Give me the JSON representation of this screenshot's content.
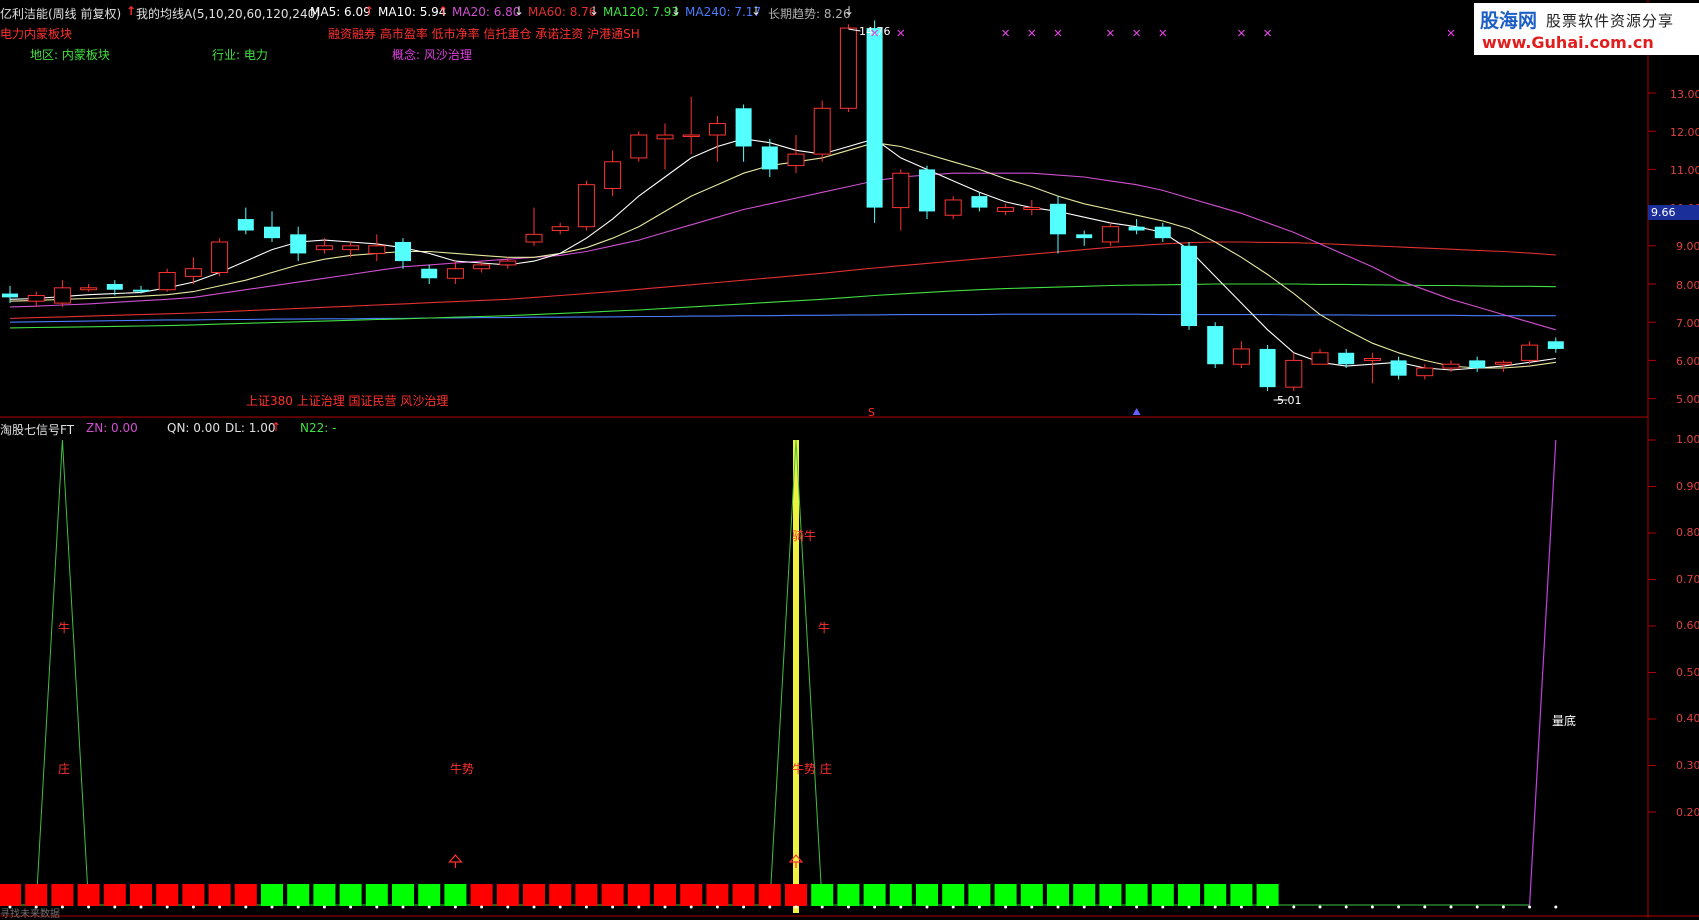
{
  "header": {
    "title": "亿利洁能(周线 前复权)",
    "ma_indicator": "我的均线A(5,10,20,60,120,240)",
    "ma_values": [
      {
        "label": "MA5: 6.09",
        "color": "#ffffff",
        "arrow": "↑"
      },
      {
        "label": "MA10: 5.94",
        "color": "#ffffff",
        "arrow": "↑"
      },
      {
        "label": "MA20: 6.80",
        "color": "#d050d0",
        "arrow": "↓"
      },
      {
        "label": "MA60: 8.76",
        "color": "#e03030",
        "arrow": "↓"
      },
      {
        "label": "MA120: 7.93",
        "color": "#40e040",
        "arrow": "↓"
      },
      {
        "label": "MA240: 7.17",
        "color": "#4a7cff",
        "arrow": "↓"
      }
    ],
    "trend": "长期趋势: 8.26"
  },
  "info": {
    "sector_tag": "电力内蒙板块",
    "concepts": "融资融券 高市盈率 低市净率 信托重仓 承诺注资 沪港通SH",
    "region": "地区: 内蒙板块",
    "industry": "行业: 电力",
    "concept": "概念: 风沙治理",
    "bottom_tags": "上证380 上证治理 国证民营 风沙治理"
  },
  "price_axis": {
    "ticks": [
      "13.00",
      "12.00",
      "11.00",
      "10.00",
      "9.00",
      "8.00",
      "7.00",
      "6.00",
      "5.00"
    ],
    "current": "9.66"
  },
  "annotations": {
    "high": "14.76",
    "low": "5.01",
    "s_marker": "S"
  },
  "sub_header": {
    "name": "淘股七信号FT",
    "zn": "ZN: 0.00",
    "qn": "QN: 0.00",
    "dl": "DL: 1.00",
    "dl_arrow": "↑",
    "n22": "N22: -"
  },
  "sub_axis": {
    "ticks": [
      "1.00",
      "0.90",
      "0.80",
      "0.70",
      "0.60",
      "0.50",
      "0.40",
      "0.30",
      "0.20"
    ]
  },
  "signals": {
    "niu_1": "牛",
    "zhuang_1": "庄",
    "niushi_1": "牛势",
    "qiniu": "骑牛",
    "niu_2": "牛",
    "niushi_zhuang": "牛势 庄",
    "liangdi": "量底"
  },
  "footer_text": "寻找未来数据",
  "logo": {
    "name": "股海网",
    "slogan": "股票软件资源分享",
    "url": "www.Guhai.com.cn"
  },
  "colors": {
    "up": "#ff3232",
    "down": "#54ffff",
    "axis": "#b00000",
    "ma5": "#ffffff",
    "ma10": "#e8e8a0",
    "ma20": "#d050d0",
    "ma60": "#e03030",
    "ma120": "#40e040",
    "ma240": "#4a7cff",
    "signal_line": "#40c040",
    "highlight": "#f0f040"
  },
  "chart_data": {
    "type": "candlestick",
    "ylim": [
      4.6,
      15.0
    ],
    "candles": [
      [
        7.75,
        7.65,
        7.95,
        7.5
      ],
      [
        7.55,
        7.7,
        7.8,
        7.4
      ],
      [
        7.5,
        7.9,
        8.1,
        7.4
      ],
      [
        7.85,
        7.9,
        8.0,
        7.8
      ],
      [
        8.0,
        7.85,
        8.1,
        7.7
      ],
      [
        7.85,
        7.8,
        7.95,
        7.75
      ],
      [
        7.85,
        8.3,
        8.4,
        7.8
      ],
      [
        8.2,
        8.4,
        8.7,
        8.0
      ],
      [
        8.3,
        9.1,
        9.2,
        8.2
      ],
      [
        9.7,
        9.4,
        10.0,
        9.3
      ],
      [
        9.5,
        9.2,
        9.9,
        9.1
      ],
      [
        9.3,
        8.8,
        9.5,
        8.6
      ],
      [
        8.9,
        9.0,
        9.2,
        8.8
      ],
      [
        8.9,
        9.0,
        9.1,
        8.7
      ],
      [
        8.8,
        9.0,
        9.3,
        8.6
      ],
      [
        9.1,
        8.6,
        9.2,
        8.4
      ],
      [
        8.4,
        8.15,
        8.5,
        8.0
      ],
      [
        8.15,
        8.4,
        8.6,
        8.0
      ],
      [
        8.4,
        8.5,
        8.6,
        8.3
      ],
      [
        8.5,
        8.6,
        8.7,
        8.4
      ],
      [
        9.1,
        9.3,
        10.0,
        9.0
      ],
      [
        9.4,
        9.5,
        9.6,
        9.3
      ],
      [
        9.5,
        10.6,
        10.7,
        9.4
      ],
      [
        10.5,
        11.2,
        11.5,
        10.3
      ],
      [
        11.3,
        11.9,
        12.0,
        11.2
      ],
      [
        11.8,
        11.9,
        12.2,
        11.0
      ],
      [
        11.9,
        11.9,
        12.9,
        11.4
      ],
      [
        11.9,
        12.2,
        12.4,
        11.2
      ],
      [
        12.6,
        11.6,
        12.7,
        11.2
      ],
      [
        11.6,
        11.0,
        11.8,
        10.8
      ],
      [
        11.1,
        11.4,
        11.9,
        10.9
      ],
      [
        11.4,
        12.6,
        12.8,
        11.2
      ],
      [
        12.6,
        14.7,
        14.8,
        12.5
      ],
      [
        14.7,
        10.0,
        14.9,
        9.6
      ],
      [
        10.0,
        10.9,
        11.0,
        9.4
      ],
      [
        11.0,
        9.9,
        11.1,
        9.7
      ],
      [
        9.8,
        10.2,
        10.3,
        9.7
      ],
      [
        10.3,
        10.0,
        10.4,
        9.9
      ],
      [
        9.9,
        10.0,
        10.1,
        9.8
      ],
      [
        9.95,
        10.0,
        10.2,
        9.8
      ],
      [
        10.1,
        9.3,
        10.3,
        8.8
      ],
      [
        9.3,
        9.2,
        9.4,
        9.0
      ],
      [
        9.1,
        9.5,
        9.6,
        9.0
      ],
      [
        9.5,
        9.4,
        9.7,
        9.3
      ],
      [
        9.5,
        9.2,
        9.6,
        9.1
      ],
      [
        9.0,
        6.9,
        9.1,
        6.8
      ],
      [
        6.9,
        5.9,
        7.0,
        5.8
      ],
      [
        5.9,
        6.3,
        6.5,
        5.8
      ],
      [
        6.3,
        5.3,
        6.4,
        5.2
      ],
      [
        5.3,
        6.0,
        6.2,
        5.2
      ],
      [
        5.9,
        6.2,
        6.3,
        5.9
      ],
      [
        6.2,
        5.9,
        6.3,
        5.8
      ],
      [
        6.0,
        6.05,
        6.2,
        5.4
      ],
      [
        6.0,
        5.6,
        6.1,
        5.5
      ],
      [
        5.6,
        5.8,
        5.9,
        5.5
      ],
      [
        5.8,
        5.9,
        6.0,
        5.7
      ],
      [
        6.0,
        5.8,
        6.1,
        5.7
      ],
      [
        5.9,
        5.95,
        6.0,
        5.7
      ],
      [
        6.0,
        6.4,
        6.5,
        5.9
      ],
      [
        6.5,
        6.3,
        6.6,
        6.2
      ]
    ],
    "ma5": [
      7.6,
      7.62,
      7.67,
      7.72,
      7.75,
      7.78,
      7.9,
      8.05,
      8.3,
      8.6,
      8.9,
      9.1,
      9.15,
      9.1,
      9.05,
      8.95,
      8.8,
      8.6,
      8.55,
      8.5,
      8.6,
      8.8,
      9.2,
      9.7,
      10.3,
      10.8,
      11.3,
      11.6,
      11.8,
      11.7,
      11.5,
      11.4,
      11.6,
      11.8,
      11.3,
      11.0,
      10.7,
      10.4,
      10.15,
      10.0,
      9.9,
      9.75,
      9.6,
      9.5,
      9.35,
      8.9,
      8.2,
      7.5,
      6.8,
      6.2,
      5.95,
      5.85,
      5.9,
      5.95,
      5.8,
      5.75,
      5.8,
      5.85,
      5.95,
      6.05
    ],
    "ma10": [
      7.55,
      7.57,
      7.6,
      7.62,
      7.65,
      7.68,
      7.72,
      7.8,
      7.95,
      8.1,
      8.3,
      8.5,
      8.65,
      8.75,
      8.8,
      8.85,
      8.85,
      8.8,
      8.75,
      8.7,
      8.7,
      8.8,
      8.95,
      9.2,
      9.5,
      9.9,
      10.3,
      10.6,
      10.9,
      11.1,
      11.2,
      11.3,
      11.5,
      11.7,
      11.6,
      11.4,
      11.2,
      11.0,
      10.75,
      10.55,
      10.3,
      10.1,
      9.95,
      9.8,
      9.65,
      9.45,
      9.1,
      8.7,
      8.25,
      7.75,
      7.2,
      6.8,
      6.45,
      6.2,
      6.0,
      5.85,
      5.8,
      5.8,
      5.85,
      5.95
    ],
    "ma20": [
      7.4,
      7.42,
      7.45,
      7.48,
      7.52,
      7.56,
      7.6,
      7.65,
      7.75,
      7.85,
      7.95,
      8.05,
      8.15,
      8.25,
      8.35,
      8.45,
      8.5,
      8.55,
      8.6,
      8.65,
      8.7,
      8.75,
      8.85,
      9.0,
      9.15,
      9.35,
      9.55,
      9.75,
      9.95,
      10.1,
      10.25,
      10.4,
      10.55,
      10.7,
      10.8,
      10.85,
      10.9,
      10.9,
      10.9,
      10.9,
      10.85,
      10.8,
      10.7,
      10.6,
      10.45,
      10.25,
      10.05,
      9.85,
      9.6,
      9.35,
      9.05,
      8.75,
      8.45,
      8.1,
      7.85,
      7.6,
      7.4,
      7.2,
      7.0,
      6.8
    ],
    "ma60": [
      7.1,
      7.12,
      7.14,
      7.16,
      7.18,
      7.2,
      7.22,
      7.24,
      7.27,
      7.3,
      7.33,
      7.36,
      7.39,
      7.42,
      7.45,
      7.48,
      7.51,
      7.54,
      7.57,
      7.6,
      7.65,
      7.7,
      7.75,
      7.8,
      7.86,
      7.92,
      7.98,
      8.04,
      8.1,
      8.16,
      8.22,
      8.28,
      8.35,
      8.42,
      8.48,
      8.54,
      8.6,
      8.66,
      8.72,
      8.78,
      8.84,
      8.9,
      8.96,
      9.0,
      9.05,
      9.08,
      9.1,
      9.1,
      9.09,
      9.08,
      9.06,
      9.03,
      9.0,
      8.97,
      8.94,
      8.91,
      8.88,
      8.85,
      8.81,
      8.76
    ],
    "ma120": [
      6.85,
      6.86,
      6.87,
      6.88,
      6.89,
      6.9,
      6.91,
      6.93,
      6.95,
      6.97,
      6.99,
      7.01,
      7.03,
      7.05,
      7.07,
      7.09,
      7.11,
      7.13,
      7.15,
      7.17,
      7.2,
      7.23,
      7.26,
      7.29,
      7.32,
      7.36,
      7.4,
      7.44,
      7.48,
      7.52,
      7.56,
      7.6,
      7.65,
      7.7,
      7.74,
      7.78,
      7.82,
      7.85,
      7.88,
      7.9,
      7.92,
      7.94,
      7.96,
      7.97,
      7.98,
      7.99,
      8.0,
      8.0,
      8.0,
      8.0,
      7.99,
      7.99,
      7.98,
      7.97,
      7.96,
      7.96,
      7.95,
      7.94,
      7.94,
      7.93
    ],
    "ma240": [
      7.0,
      7.01,
      7.02,
      7.03,
      7.04,
      7.05,
      7.06,
      7.06,
      7.07,
      7.07,
      7.08,
      7.08,
      7.09,
      7.09,
      7.1,
      7.1,
      7.11,
      7.11,
      7.12,
      7.12,
      7.13,
      7.13,
      7.14,
      7.14,
      7.15,
      7.15,
      7.16,
      7.16,
      7.17,
      7.17,
      7.18,
      7.18,
      7.19,
      7.19,
      7.2,
      7.2,
      7.2,
      7.2,
      7.21,
      7.21,
      7.21,
      7.21,
      7.21,
      7.21,
      7.2,
      7.2,
      7.2,
      7.2,
      7.2,
      7.19,
      7.19,
      7.19,
      7.18,
      7.18,
      7.18,
      7.18,
      7.17,
      7.17,
      7.17,
      7.17
    ],
    "sub_signal": [
      0,
      0,
      1,
      0,
      0,
      0,
      0,
      0,
      0,
      0,
      0,
      0,
      0,
      0,
      0,
      0,
      0,
      0,
      0,
      0,
      0,
      0,
      0,
      0,
      0,
      0,
      0,
      0,
      0,
      0,
      1,
      0,
      0,
      0,
      0,
      0,
      0,
      0,
      0,
      0,
      0,
      0,
      0,
      0,
      0,
      0,
      0,
      0,
      0,
      0,
      0,
      0,
      0,
      0,
      0,
      0,
      0,
      0,
      0,
      1
    ],
    "bottom_bars": [
      "r",
      "r",
      "r",
      "r",
      "r",
      "r",
      "r",
      "r",
      "r",
      "r",
      "g",
      "g",
      "g",
      "g",
      "g",
      "g",
      "g",
      "g",
      "r",
      "r",
      "r",
      "r",
      "r",
      "r",
      "r",
      "r",
      "r",
      "r",
      "r",
      "r",
      "r",
      "g",
      "g",
      "g",
      "g",
      "g",
      "g",
      "g",
      "g",
      "g",
      "g",
      "g",
      "g",
      "g",
      "g",
      "g",
      "g",
      "g",
      "g",
      "n",
      "n",
      "n",
      "n",
      "n",
      "n",
      "n",
      "n",
      "n",
      "n",
      "n"
    ]
  }
}
